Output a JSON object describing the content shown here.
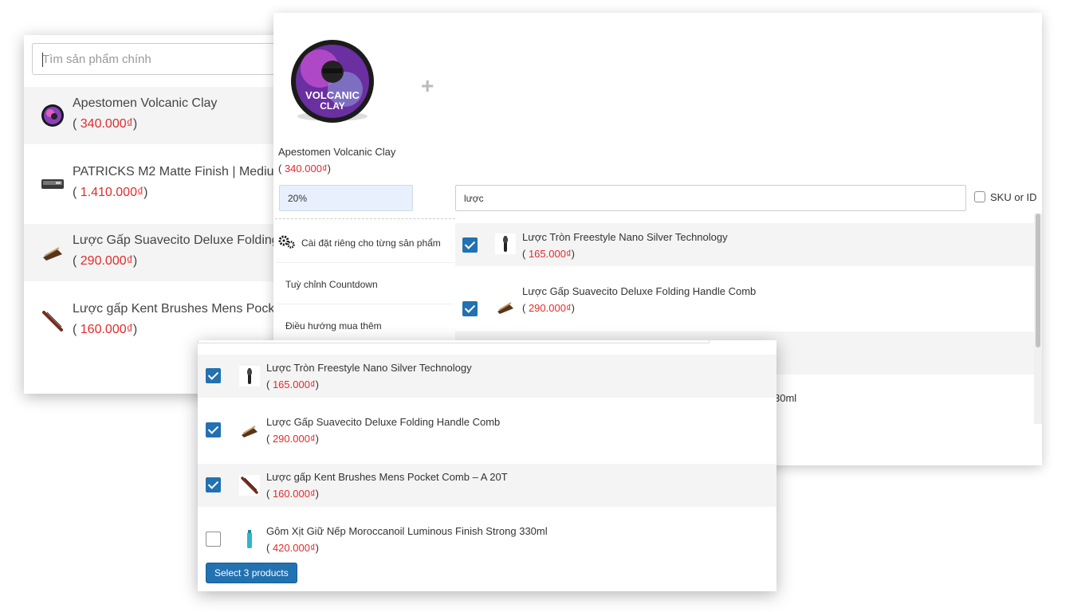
{
  "main_search": {
    "placeholder": "Tìm sản phẩm chính",
    "results": [
      {
        "name": "Apestomen Volcanic Clay",
        "price": "340.000₫",
        "thumb_icon": "clay-jar-icon"
      },
      {
        "name": "PATRICKS M2 Matte Finish | Mediu",
        "price": "1.410.000₫",
        "thumb_icon": "pomade-tin-icon"
      },
      {
        "name": "Lược Gấp Suavecito Deluxe Folding",
        "price": "290.000₫",
        "thumb_icon": "folding-comb-icon"
      },
      {
        "name": "Lược gấp Kent Brushes Mens Pocke",
        "price": "160.000₫",
        "thumb_icon": "pocket-comb-icon"
      }
    ]
  },
  "bundle": {
    "product_name": "Apestomen Volcanic Clay",
    "product_price": "340.000₫",
    "product_image_icon": "volcanic-clay-jar-icon",
    "add_icon": "plus-icon",
    "discount_value": "20%",
    "settings": [
      {
        "label": "Cài đặt riêng cho từng sản phẩm",
        "icon": "gears-icon"
      },
      {
        "label": "Tuỳ chỉnh Countdown"
      },
      {
        "label": "Điều hướng mua thêm"
      }
    ],
    "search_value": "lược",
    "sku_label": "SKU or ID",
    "partial_row_text": "30ml"
  },
  "picker_back": {
    "items": [
      {
        "name": "Lược Tròn Freestyle Nano Silver Technology",
        "price": "165.000₫",
        "checked": true
      },
      {
        "name": "Lược Gấp Suavecito Deluxe Folding Handle Comb",
        "price": "290.000₫",
        "checked": true
      }
    ]
  },
  "picker_front": {
    "items": [
      {
        "name": "Lược Tròn Freestyle Nano Silver Technology",
        "price": "165.000₫",
        "checked": true
      },
      {
        "name": "Lược Gấp Suavecito Deluxe Folding Handle Comb",
        "price": "290.000₫",
        "checked": true
      },
      {
        "name": "Lược gấp Kent Brushes Mens Pocket Comb – A 20T",
        "price": "160.000₫",
        "checked": true
      },
      {
        "name": "Gôm Xịt Giữ Nếp Moroccanoil Luminous Finish Strong 330ml",
        "price": "420.000₫",
        "checked": false
      }
    ],
    "select_button": "Select 3 products"
  },
  "colors": {
    "price": "#e32b2b",
    "accent": "#2271b1",
    "discount_bg": "#e8f0fe"
  }
}
